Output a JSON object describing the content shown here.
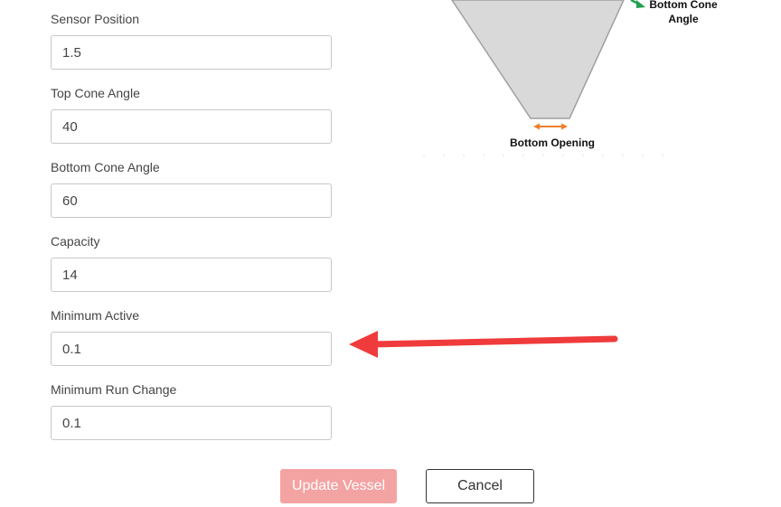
{
  "fields": [
    {
      "label": "Sensor Position",
      "value": "1.5"
    },
    {
      "label": "Top Cone Angle",
      "value": "40"
    },
    {
      "label": "Bottom Cone Angle",
      "value": "60"
    },
    {
      "label": "Capacity",
      "value": "14"
    },
    {
      "label": "Minimum Active",
      "value": "0.1"
    },
    {
      "label": "Minimum Run Change",
      "value": "0.1"
    }
  ],
  "diagram": {
    "bottom_cone_angle_line1": "Bottom Cone",
    "bottom_cone_angle_line2": "Angle",
    "bottom_opening_label": "Bottom Opening"
  },
  "buttons": {
    "update_label": "Update Vessel",
    "cancel_label": "Cancel"
  },
  "colors": {
    "update_button_bg": "#f4a3a3",
    "annotation_arrow": "#ef3b3b",
    "opening_arrow": "#f07f2a",
    "angle_arrow": "#22a050"
  }
}
